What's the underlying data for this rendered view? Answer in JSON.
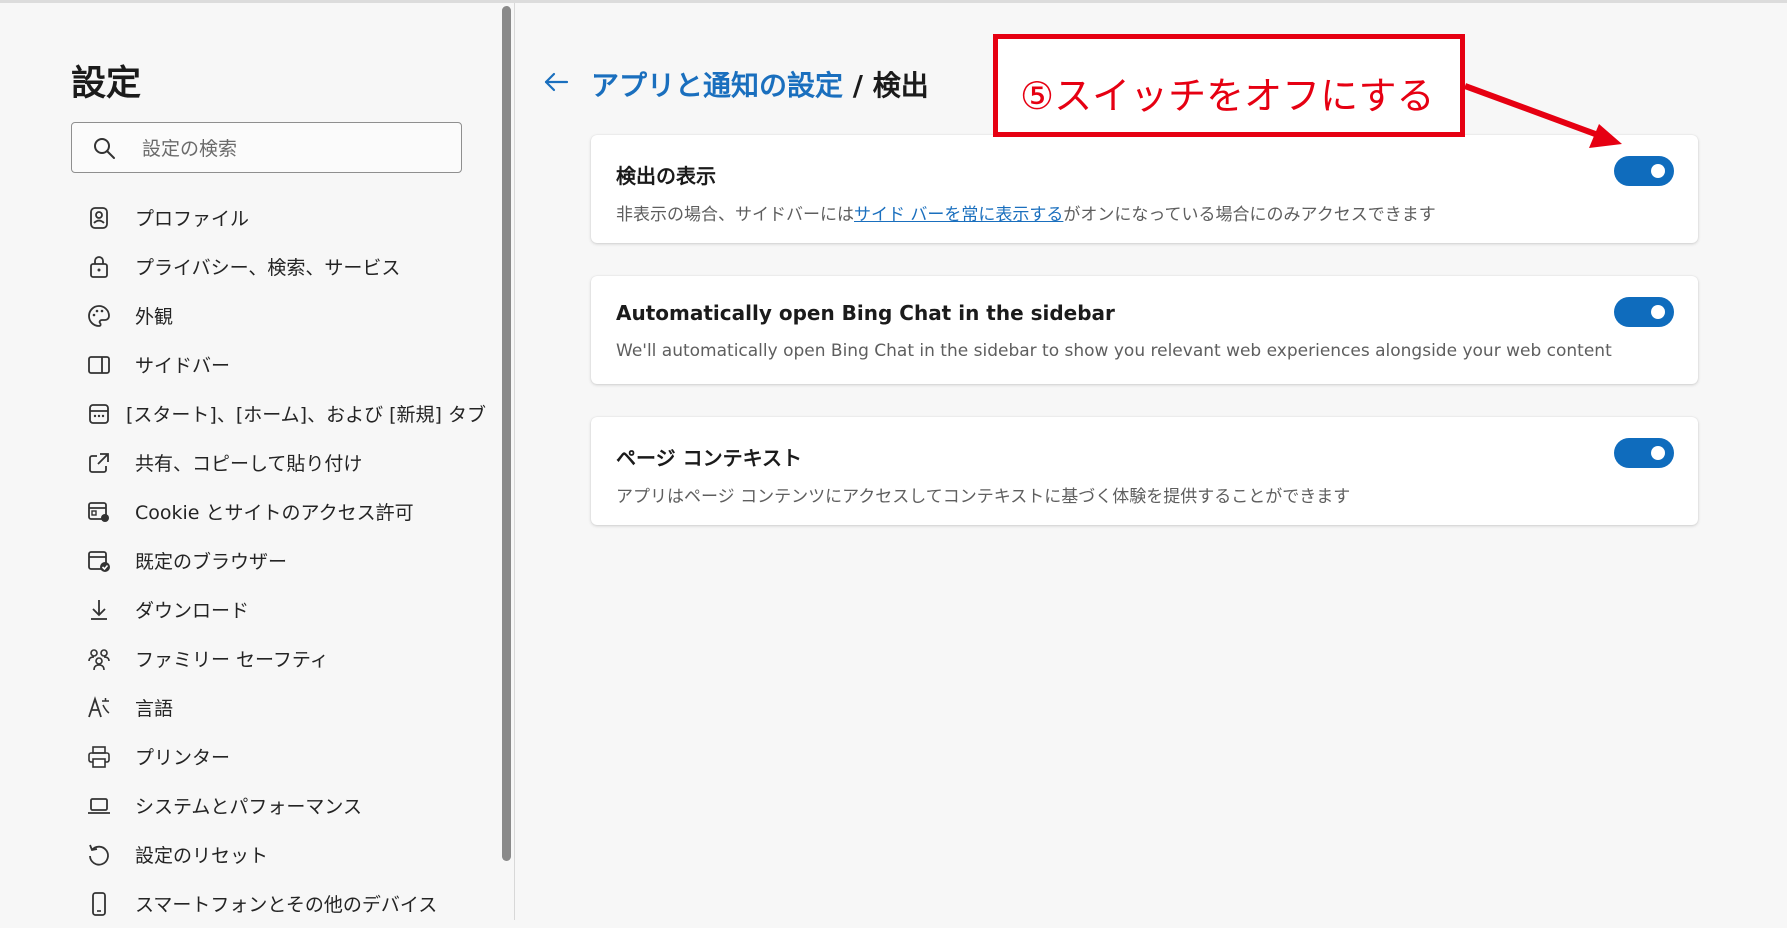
{
  "sidebar": {
    "title": "設定",
    "search_placeholder": "設定の検索",
    "items": [
      {
        "label": "プロファイル",
        "icon": "profile-icon"
      },
      {
        "label": "プライバシー、検索、サービス",
        "icon": "lock-icon"
      },
      {
        "label": "外観",
        "icon": "palette-icon"
      },
      {
        "label": "サイドバー",
        "icon": "sidebar-icon"
      },
      {
        "label": "[スタート]、[ホーム]、および [新規] タブ",
        "icon": "home-tab-icon"
      },
      {
        "label": "共有、コピーして貼り付け",
        "icon": "share-icon"
      },
      {
        "label": "Cookie とサイトのアクセス許可",
        "icon": "site-permissions-icon"
      },
      {
        "label": "既定のブラウザー",
        "icon": "default-browser-icon"
      },
      {
        "label": "ダウンロード",
        "icon": "download-icon"
      },
      {
        "label": "ファミリー セーフティ",
        "icon": "family-icon"
      },
      {
        "label": "言語",
        "icon": "language-icon"
      },
      {
        "label": "プリンター",
        "icon": "printer-icon"
      },
      {
        "label": "システムとパフォーマンス",
        "icon": "laptop-icon"
      },
      {
        "label": "設定のリセット",
        "icon": "reset-icon"
      },
      {
        "label": "スマートフォンとその他のデバイス",
        "icon": "phone-icon"
      }
    ]
  },
  "breadcrumb": {
    "parent": "アプリと通知の設定",
    "separator": " / ",
    "current": "検出"
  },
  "cards": [
    {
      "title": "検出の表示",
      "desc_before": "非表示の場合、サイドバーには",
      "desc_link": "サイド バーを常に表示する",
      "desc_after": "がオンになっている場合にのみアクセスできます",
      "toggle_on": true
    },
    {
      "title": "Automatically open Bing Chat in the sidebar",
      "desc": "We'll automatically open Bing Chat in the sidebar to show you relevant web experiences alongside your web content",
      "toggle_on": true
    },
    {
      "title": "ページ コンテキスト",
      "desc": "アプリはページ コンテンツにアクセスしてコンテキストに基づく体験を提供することができます",
      "toggle_on": true
    }
  ],
  "annotation": {
    "text": "⑤スイッチをオフにする",
    "color": "#e60012"
  },
  "colors": {
    "accent": "#0f6cbd",
    "link": "#1a6fbe",
    "annotation": "#e60012"
  }
}
